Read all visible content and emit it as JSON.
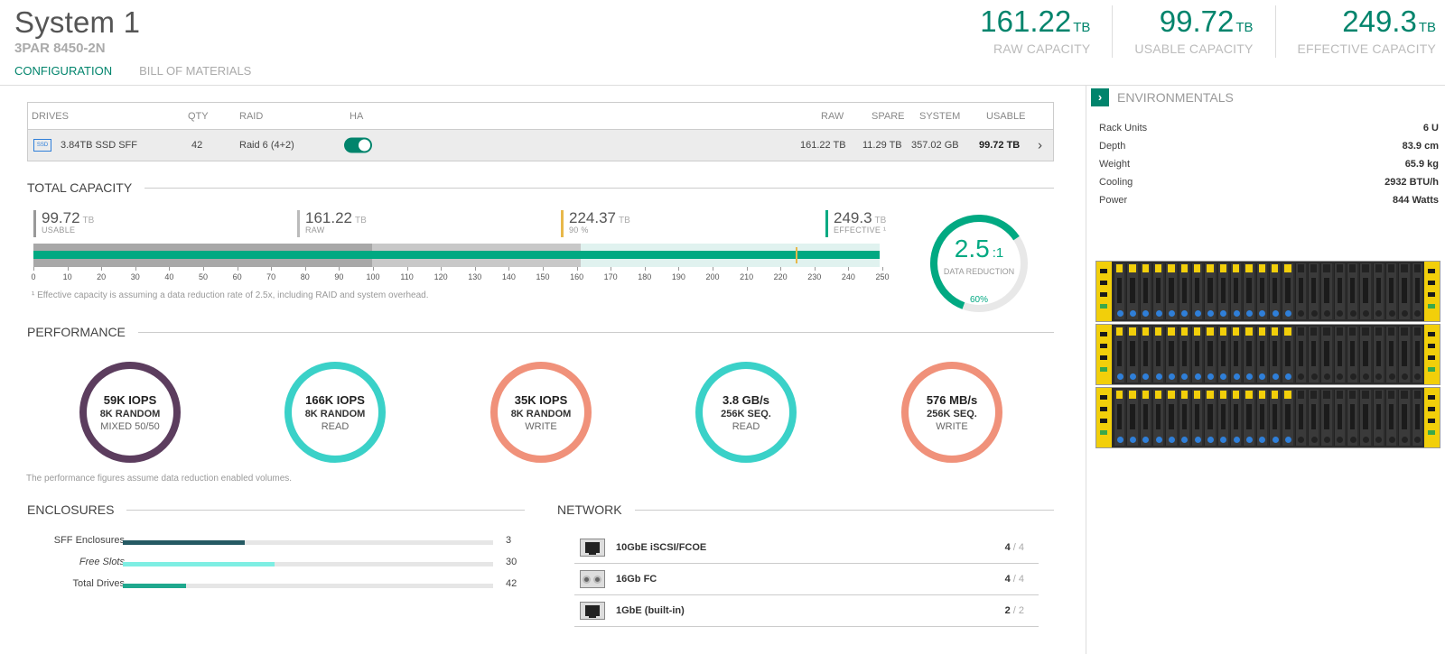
{
  "header": {
    "title": "System 1",
    "model": "3PAR 8450-2N",
    "tabs": [
      {
        "label": "CONFIGURATION",
        "active": true
      },
      {
        "label": "BILL OF MATERIALS",
        "active": false
      }
    ],
    "metrics": [
      {
        "value": "161.22",
        "unit": "TB",
        "label": "RAW CAPACITY"
      },
      {
        "value": "99.72",
        "unit": "TB",
        "label": "USABLE CAPACITY"
      },
      {
        "value": "249.3",
        "unit": "TB",
        "label": "EFFECTIVE CAPACITY"
      }
    ]
  },
  "drives_table": {
    "headers": {
      "drives": "DRIVES",
      "qty": "QTY",
      "raid": "RAID",
      "ha": "HA",
      "raw": "RAW",
      "spare": "SPARE",
      "system": "SYSTEM",
      "usable": "USABLE"
    },
    "row": {
      "icon_text": "SSD",
      "drive": "3.84TB SSD SFF",
      "qty": "42",
      "raid": "Raid 6 (4+2)",
      "ha_enabled": true,
      "raw": "161.22 TB",
      "spare": "11.29 TB",
      "system": "357.02 GB",
      "usable": "99.72 TB"
    }
  },
  "total_capacity": {
    "title": "TOTAL CAPACITY",
    "markers": [
      {
        "value": "99.72",
        "unit": "TB",
        "label": "USABLE",
        "color": "#999999"
      },
      {
        "value": "161.22",
        "unit": "TB",
        "label": "RAW",
        "color": "#bbbbbb"
      },
      {
        "value": "224.37",
        "unit": "TB",
        "label": "90 %",
        "color": "#e8b84a"
      },
      {
        "value": "249.3",
        "unit": "TB",
        "label": "EFFECTIVE ¹",
        "color": "#01a982"
      }
    ],
    "bar_values": {
      "usable": 99.72,
      "raw": 161.22,
      "threshold": 224.37,
      "effective": 249.3,
      "max": 250
    },
    "ticks": [
      "0",
      "10",
      "20",
      "30",
      "40",
      "50",
      "60",
      "70",
      "80",
      "90",
      "100",
      "110",
      "120",
      "130",
      "140",
      "150",
      "160",
      "170",
      "180",
      "190",
      "200",
      "210",
      "220",
      "230",
      "240",
      "250"
    ],
    "footnote": "¹ Effective capacity is assuming a data reduction rate of 2.5x, including RAID and system overhead.",
    "gauge": {
      "ratio": "2.5",
      "suffix": ":1",
      "label": "DATA REDUCTION",
      "percent_label": "60%",
      "percent": 60
    }
  },
  "performance": {
    "title": "PERFORMANCE",
    "items": [
      {
        "value": "59K IOPS",
        "line2": "8K RANDOM",
        "line3": "MIXED 50/50",
        "color": "#5c3d5e"
      },
      {
        "value": "166K IOPS",
        "line2": "8K RANDOM",
        "line3": "READ",
        "color": "#3ad1c8"
      },
      {
        "value": "35K IOPS",
        "line2": "8K RANDOM",
        "line3": "WRITE",
        "color": "#f0917a"
      },
      {
        "value": "3.8 GB/s",
        "line2": "256K SEQ.",
        "line3": "READ",
        "color": "#3ad1c8"
      },
      {
        "value": "576 MB/s",
        "line2": "256K SEQ.",
        "line3": "WRITE",
        "color": "#f0917a"
      }
    ],
    "footnote": "The performance figures assume data reduction enabled volumes."
  },
  "enclosures": {
    "title": "ENCLOSURES",
    "rows": [
      {
        "label": "SFF Enclosures",
        "value": "3",
        "fraction": 0.33,
        "color": "#255a63",
        "italic": false
      },
      {
        "label": "Free Slots",
        "value": "30",
        "fraction": 0.41,
        "color": "#7eeee3",
        "italic": true
      },
      {
        "label": "Total Drives",
        "value": "42",
        "fraction": 0.17,
        "color": "#1fa88e",
        "italic": false
      }
    ]
  },
  "network": {
    "title": "NETWORK",
    "rows": [
      {
        "name": "10GbE iSCSI/FCOE",
        "used": "4",
        "total": "/ 4",
        "icon": "ethernet-port-icon"
      },
      {
        "name": "16Gb FC",
        "used": "4",
        "total": "/ 4",
        "icon": "fibre-channel-port-icon"
      },
      {
        "name": "1GbE (built-in)",
        "used": "2",
        "total": "/ 2",
        "icon": "ethernet-port-icon"
      }
    ]
  },
  "environmentals": {
    "title": "ENVIRONMENTALS",
    "rows": [
      {
        "label": "Rack Units",
        "value": "6 U"
      },
      {
        "label": "Depth",
        "value": "83.9 cm"
      },
      {
        "label": "Weight",
        "value": "65.9 kg"
      },
      {
        "label": "Cooling",
        "value": "2932 BTU/h"
      },
      {
        "label": "Power",
        "value": "844 Watts"
      }
    ],
    "enclosure_bays": 24,
    "filled_bays": [
      14,
      14,
      14
    ]
  },
  "colors": {
    "accent": "#01846c",
    "bar_effective": "#01a982",
    "bar_raw": "#c8c8c8",
    "bar_usable": "#a8a8a8",
    "bar_track": "#e0f2ef"
  }
}
